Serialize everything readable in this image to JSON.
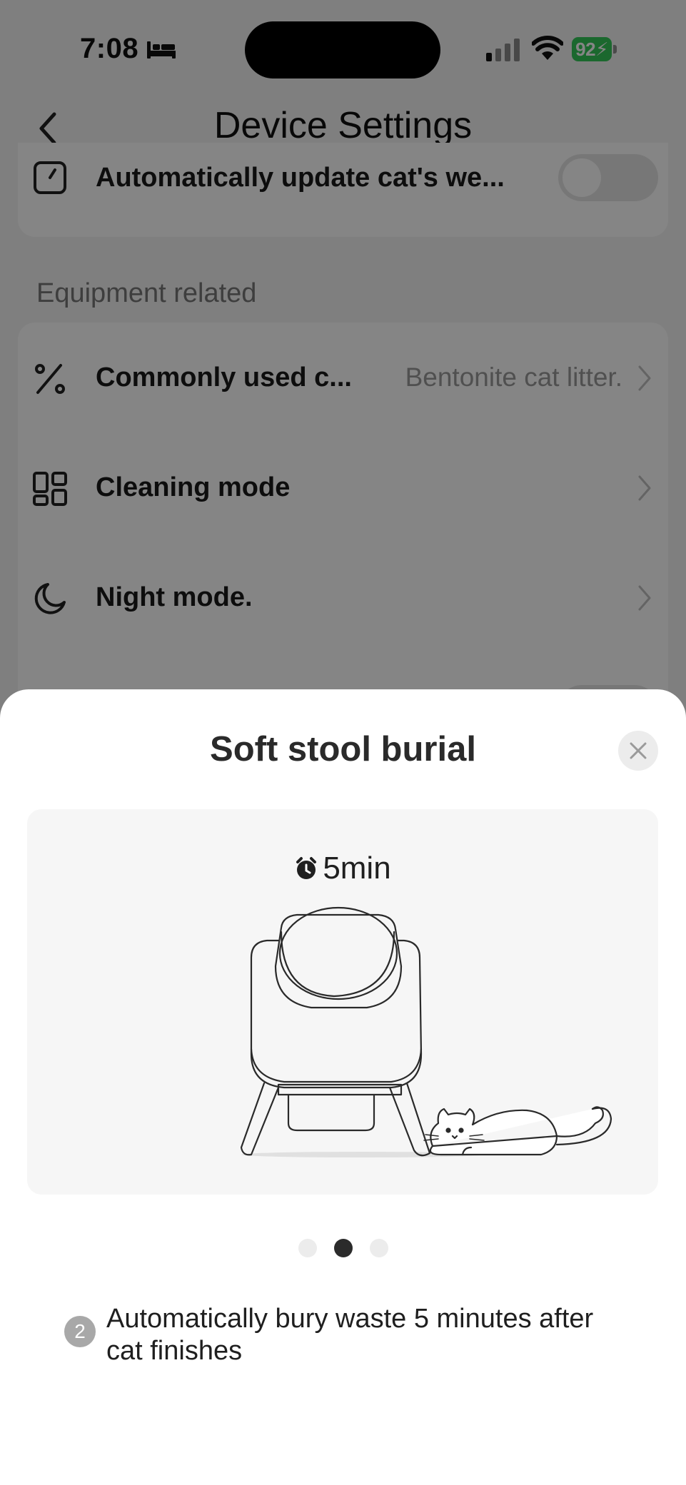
{
  "status_bar": {
    "time": "7:08",
    "battery": "92"
  },
  "nav": {
    "title": "Device Settings"
  },
  "settings": {
    "top_row": {
      "label": "Automatically update cat's we..."
    },
    "section_title": "Equipment related",
    "rows": [
      {
        "label": "Commonly used c...",
        "value": "Bentonite cat litter."
      },
      {
        "label": "Cleaning mode",
        "value": ""
      },
      {
        "label": "Night mode.",
        "value": ""
      }
    ]
  },
  "sheet": {
    "title": "Soft stool burial",
    "timer": "5min",
    "pager": {
      "count": 3,
      "active_index": 1
    },
    "step": {
      "number": "2",
      "text": "Automatically bury waste 5 minutes after cat finishes"
    }
  },
  "colors": {
    "battery": "#34c759",
    "overlay": "rgba(0,0,0,0.48)",
    "sheet": "#ffffff"
  }
}
